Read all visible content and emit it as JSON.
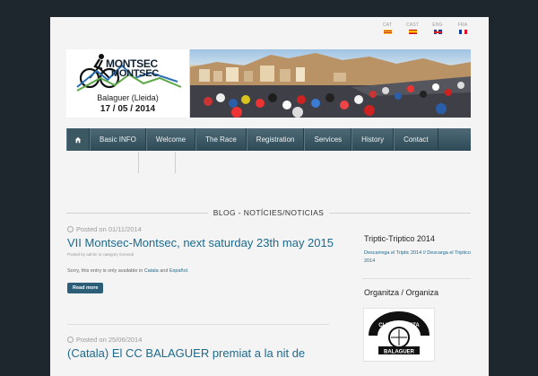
{
  "languages": [
    {
      "code": "CAT",
      "flag": "catalonia-flag-icon"
    },
    {
      "code": "CAST",
      "flag": "spain-flag-icon"
    },
    {
      "code": "ENG",
      "flag": "uk-flag-icon"
    },
    {
      "code": "FRA",
      "flag": "france-flag-icon"
    }
  ],
  "logo": {
    "line1": "MONTSEC",
    "line2": "MONTSEC",
    "place": "Balaguer (Lleida)",
    "date": "17 / 05 / 2014"
  },
  "nav": {
    "items": [
      "Basic INFO",
      "Welcome",
      "The Race",
      "Registration",
      "Services",
      "History",
      "Contact"
    ]
  },
  "section": {
    "title": "BLOG - NOTÍCIES/NOTICIAS"
  },
  "posts": [
    {
      "date": "Posted on 01/11/2014",
      "title": "VII Montsec-Montsec, next saturday 23th may 2015",
      "by": "Posted by admin in category General",
      "text_prefix": "Sorry, this entry is only available in",
      "link1": "Catala",
      "text_and": "and",
      "link2": "Español",
      "text_suffix": ".",
      "read_more": "Read more"
    },
    {
      "date": "Posted on 25/06/2014",
      "title": "(Catala) El CC BALAGUER premiat a la nit de"
    }
  ],
  "sidebar": {
    "widget1_title": "Triptic-Triptico 2014",
    "widget1_link": "Descarrega el Triptic 2014 // Descarga el Triptico 2014",
    "widget2_title": "Organitza / Organiza",
    "club_text1": "CLUB CICLISTA",
    "club_text2": "BALAGUER"
  },
  "colors": {
    "background": "#1e272d",
    "nav": "#3c5863",
    "link": "#1c6a8e",
    "button": "#2c5f77"
  }
}
